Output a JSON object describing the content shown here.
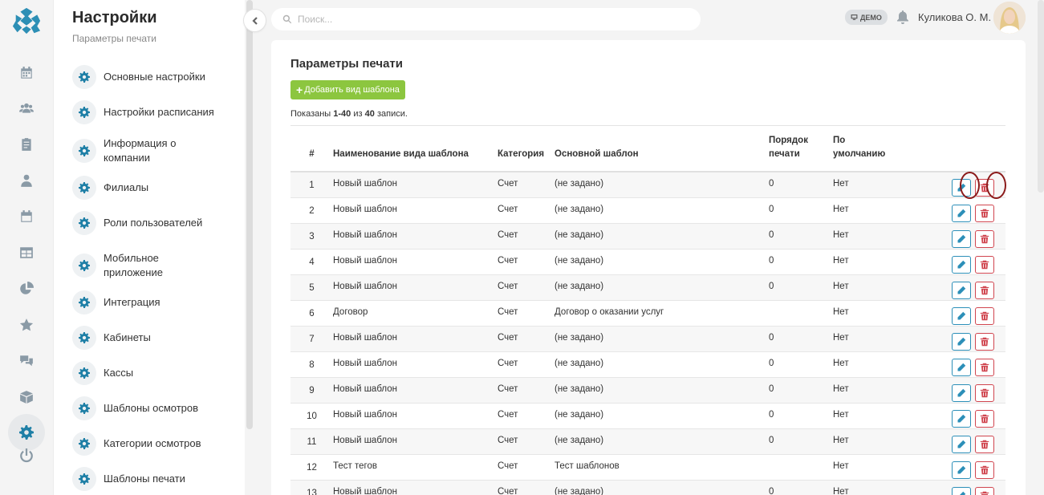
{
  "sidebar": {
    "title": "Настройки",
    "subtitle": "Параметры печати",
    "items": [
      {
        "label": "Основные настройки"
      },
      {
        "label": "Настройки расписания"
      },
      {
        "label": "Информация о компании"
      },
      {
        "label": "Филиалы"
      },
      {
        "label": "Роли пользователей"
      },
      {
        "label": "Мобильное приложение"
      },
      {
        "label": "Интеграция"
      },
      {
        "label": "Кабинеты"
      },
      {
        "label": "Кассы"
      },
      {
        "label": "Шаблоны осмотров"
      },
      {
        "label": "Категории осмотров"
      },
      {
        "label": "Шаблоны печати"
      }
    ]
  },
  "rail": {
    "icons": [
      "calendar-icon",
      "users-icon",
      "clipboard-icon",
      "doctor-icon",
      "schedule-icon",
      "table-icon",
      "pie-chart-icon",
      "star-icon",
      "chat-icon",
      "box-icon",
      "settings-icon",
      "power-icon"
    ]
  },
  "topbar": {
    "search_placeholder": "Поиск...",
    "demo_label": "ДЕМО",
    "user_name": "Куликова О. М."
  },
  "main": {
    "title": "Параметры печати",
    "add_button": "Добавить вид шаблона",
    "summary": {
      "prefix": "Показаны",
      "range": "1-40",
      "of": "из",
      "total": "40",
      "suffix": "записи."
    },
    "columns": {
      "num": "#",
      "name": "Наименование вида шаблона",
      "category": "Категория",
      "template": "Основной шаблон",
      "order": "Порядок печати",
      "default": "По умолчанию"
    },
    "rows": [
      {
        "num": "1",
        "name": "Новый шаблон",
        "category": "Счет",
        "template": "(не задано)",
        "order": "0",
        "default": "Нет"
      },
      {
        "num": "2",
        "name": "Новый шаблон",
        "category": "Счет",
        "template": "(не задано)",
        "order": "0",
        "default": "Нет"
      },
      {
        "num": "3",
        "name": "Новый шаблон",
        "category": "Счет",
        "template": "(не задано)",
        "order": "0",
        "default": "Нет"
      },
      {
        "num": "4",
        "name": "Новый шаблон",
        "category": "Счет",
        "template": "(не задано)",
        "order": "0",
        "default": "Нет"
      },
      {
        "num": "5",
        "name": "Новый шаблон",
        "category": "Счет",
        "template": "(не задано)",
        "order": "0",
        "default": "Нет"
      },
      {
        "num": "6",
        "name": "Договор",
        "category": "Счет",
        "template": "Договор о оказании услуг",
        "order": "",
        "default": "Нет"
      },
      {
        "num": "7",
        "name": "Новый шаблон",
        "category": "Счет",
        "template": "(не задано)",
        "order": "0",
        "default": "Нет"
      },
      {
        "num": "8",
        "name": "Новый шаблон",
        "category": "Счет",
        "template": "(не задано)",
        "order": "0",
        "default": "Нет"
      },
      {
        "num": "9",
        "name": "Новый шаблон",
        "category": "Счет",
        "template": "(не задано)",
        "order": "0",
        "default": "Нет"
      },
      {
        "num": "10",
        "name": "Новый шаблон",
        "category": "Счет",
        "template": "(не задано)",
        "order": "0",
        "default": "Нет"
      },
      {
        "num": "11",
        "name": "Новый шаблон",
        "category": "Счет",
        "template": "(не задано)",
        "order": "0",
        "default": "Нет"
      },
      {
        "num": "12",
        "name": "Тест тегов",
        "category": "Счет",
        "template": "Тест шаблонов",
        "order": "",
        "default": "Нет"
      },
      {
        "num": "13",
        "name": "Новый шаблон",
        "category": "Счет",
        "template": "(не задано)",
        "order": "0",
        "default": "Нет"
      }
    ]
  },
  "colors": {
    "accent": "#1e7fa6",
    "add_button": "#8cc63f",
    "delete": "#d0454f",
    "highlight_ring": "#8b1a1a"
  }
}
